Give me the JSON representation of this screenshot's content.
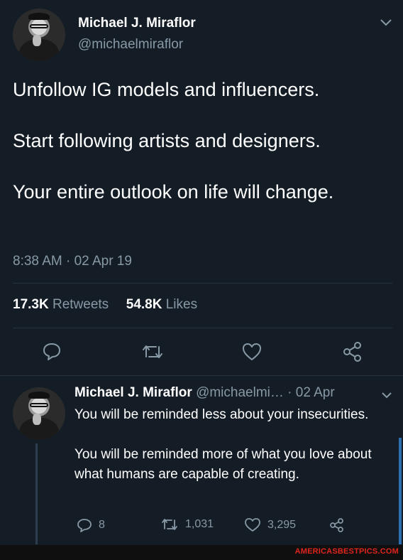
{
  "main_tweet": {
    "name": "Michael J. Miraflor",
    "handle": "@michaelmiraflor",
    "text": "Unfollow IG models and influencers.\n\nStart following artists and designers.\n\nYour entire outlook on life will change.",
    "timestamp": "8:38 AM · 02 Apr 19",
    "retweets_count": "17.3K",
    "retweets_label": "Retweets",
    "likes_count": "54.8K",
    "likes_label": "Likes",
    "actions": [
      "reply-icon",
      "retweet-icon",
      "like-icon",
      "share-icon"
    ]
  },
  "reply": {
    "name": "Michael J. Miraflor",
    "handle_date": "@michaelmi… · 02 Apr",
    "text": "You will be reminded less about your insecurities.\n\nYou will be reminded more of what you love about what humans are capable of creating.",
    "reply_count": "8",
    "retweet_count": "1,031",
    "like_count": "3,295"
  },
  "watermark": "AMERICASBESTPICS.COM",
  "colors": {
    "background": "#141d26",
    "muted": "#8899a6",
    "divider": "#253341",
    "watermark": "#e0241b"
  }
}
